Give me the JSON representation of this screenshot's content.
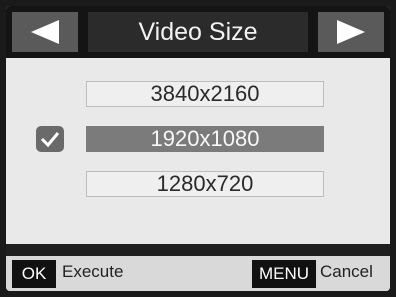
{
  "header": {
    "title": "Video Size",
    "left_arrow_icon": "triangle-left",
    "right_arrow_icon": "triangle-right"
  },
  "options": [
    {
      "label": "3840x2160",
      "selected": false
    },
    {
      "label": "1920x1080",
      "selected": true
    },
    {
      "label": "1280x720",
      "selected": false
    }
  ],
  "footer": {
    "ok_key": "OK",
    "ok_action": "Execute",
    "menu_key": "MENU",
    "menu_action": "Cancel"
  },
  "colors": {
    "selected_bg": "#7b7b7b",
    "screen_bg": "#e9e9e9",
    "header_bg": "#141414"
  }
}
